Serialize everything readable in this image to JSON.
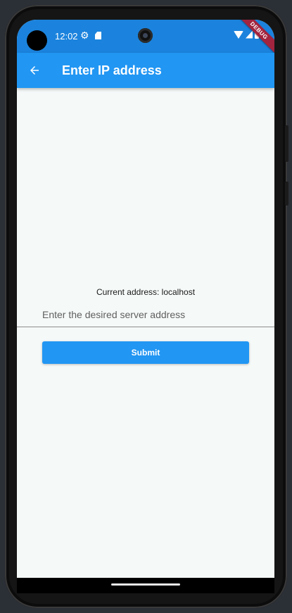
{
  "status_bar": {
    "time": "12:02",
    "icons": [
      "settings-gear-icon",
      "sd-card-icon",
      "wifi-icon",
      "cell-signal-icon",
      "battery-icon"
    ],
    "debug_banner": "DEBUG"
  },
  "app_bar": {
    "title": "Enter IP address",
    "back_icon": "arrow-back-icon",
    "color": "#2196f3"
  },
  "form": {
    "current_address_label": "Current address: localhost",
    "input_value": "",
    "input_placeholder": "Enter the desired server address",
    "submit_label": "Submit"
  },
  "colors": {
    "status_bar": "#1b83dd",
    "accent": "#2196f3",
    "background": "#f5f9f8",
    "debug_banner": "#a3243e"
  }
}
